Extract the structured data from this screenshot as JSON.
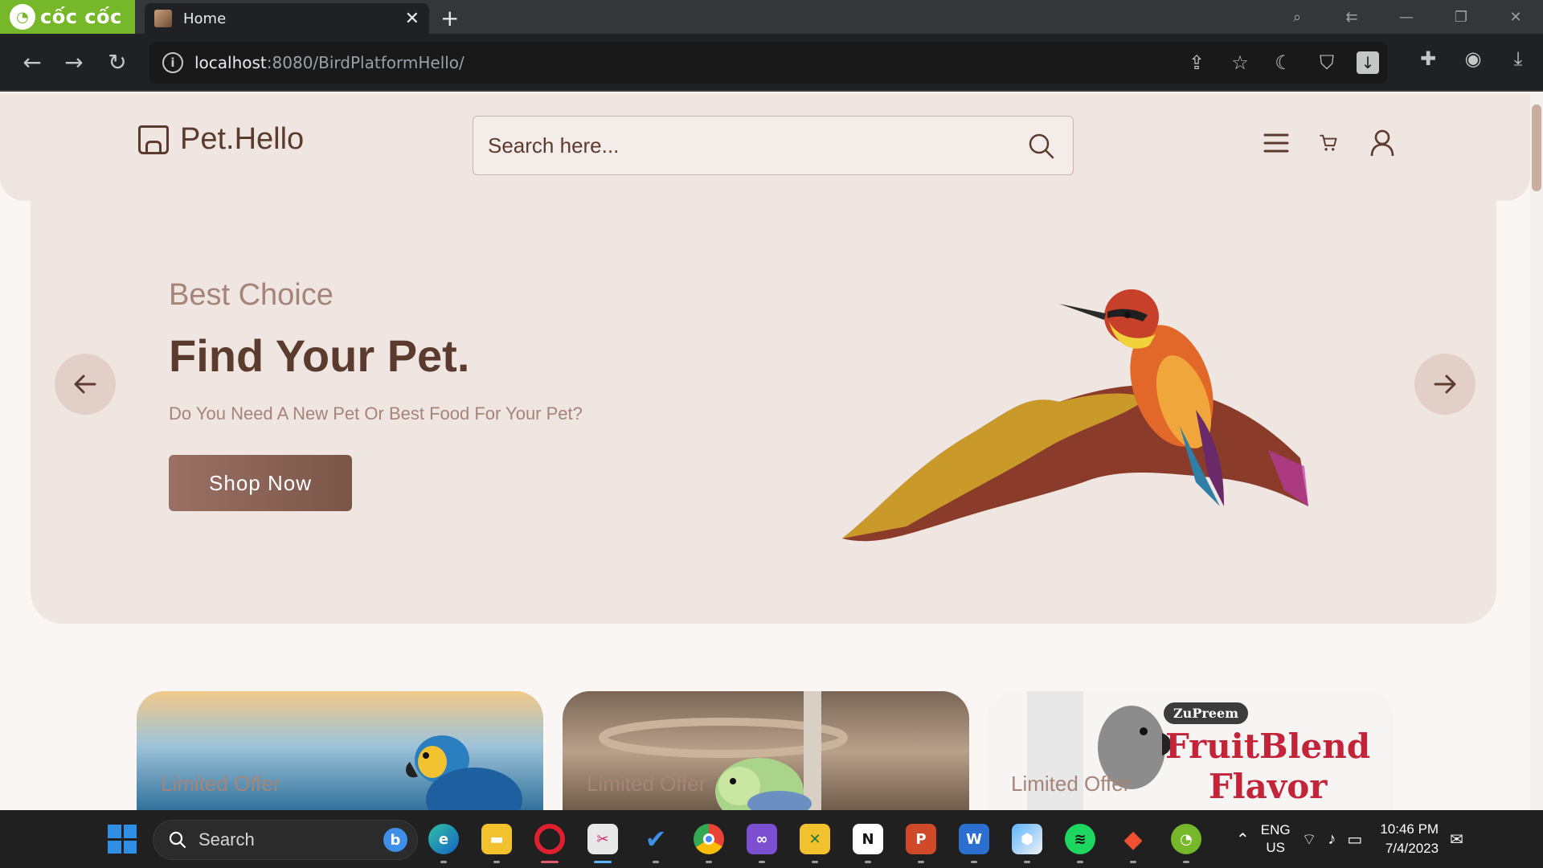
{
  "browser": {
    "brand_name": "cốc cốc",
    "tab_title": "Home",
    "url_host": "localhost",
    "url_rest": ":8080/BirdPlatformHello/"
  },
  "site": {
    "logo_text": "Pet.Hello",
    "search_placeholder": "Search here...",
    "hero": {
      "subtitle": "Best Choice",
      "title": "Find Your Pet.",
      "description": "Do You Need A New Pet Or Best Food For Your Pet?",
      "button": "Shop Now"
    },
    "offers": [
      {
        "label": "Limited Offer"
      },
      {
        "label": "Limited Offer"
      },
      {
        "label": "Limited Offer",
        "brand": "ZuPreem",
        "product_line1": "FruitBlend",
        "product_line2": "Flavor"
      }
    ]
  },
  "taskbar": {
    "search_label": "Search",
    "lang_line1": "ENG",
    "lang_line2": "US",
    "time": "10:46 PM",
    "date": "7/4/2023"
  },
  "colors": {
    "accent": "#5b3b2e",
    "muted": "#a5847a",
    "panel": "#efe5e1",
    "browser_brand": "#76b82a"
  }
}
